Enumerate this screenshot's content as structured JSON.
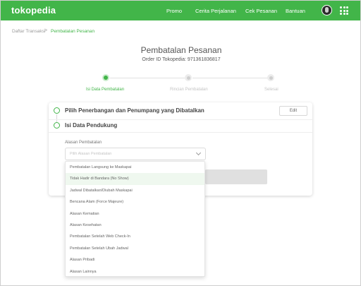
{
  "header": {
    "logo": "tokopedia",
    "nav": [
      "Promo",
      "Cerita Perjalanan",
      "Cek Pesanan",
      "Bantuan"
    ],
    "colors": {
      "brand": "#42b549"
    }
  },
  "breadcrumb": {
    "items": [
      "Daftar Transaksi",
      "Pembatalan Pesanan"
    ],
    "separator": ">"
  },
  "page": {
    "title": "Pembatalan Pesanan",
    "order_id": "Order ID Tokopedia: 971361836817"
  },
  "steps": [
    {
      "label": "Isi Data Pembatalan",
      "active": true
    },
    {
      "label": "Rincian Pembatalan",
      "active": false
    },
    {
      "label": "Selesai",
      "active": false
    }
  ],
  "card": {
    "section1_title": "Pilih Penerbangan dan Penumpang yang Dibatalkan",
    "edit_label": "Edit",
    "section2_title": "Isi Data Pendukung",
    "field_label": "Alasan Pembatalan",
    "select_placeholder": "Pilih Alasan Pembatalan"
  },
  "dropdown": {
    "options": [
      "Pembatalan Langsung ke Maskapai",
      "Tidak Hadir di Bandara (No Show)",
      "Jadwal Dibatalkan/Diubah Maskapai",
      "Bencana Alam (Force Majeure)",
      "Alasan Kematian",
      "Alasan Kesehatan",
      "Pembatalan Setelah Web Check-In",
      "Pembatalan Setelah Ubah Jadwal",
      "Alasan Pribadi",
      "Alasan Lainnya"
    ],
    "highlighted": "Tidak Hadir di Bandara (No Show)"
  }
}
